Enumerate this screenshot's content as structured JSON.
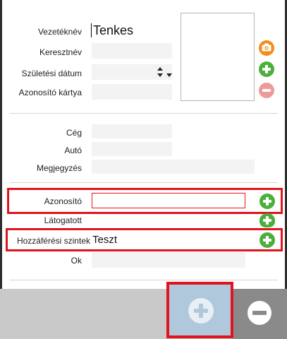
{
  "form": {
    "surname_label": "Vezetéknév",
    "surname_value": "Tenkes",
    "firstname_label": "Keresztnév",
    "firstname_value": "",
    "birthdate_label": "Születési dátum",
    "birthdate_value": "",
    "idcard_label": "Azonosító kártya",
    "idcard_value": "",
    "company_label": "Cég",
    "company_value": "",
    "car_label": "Autó",
    "car_value": "",
    "note_label": "Megjegyzés",
    "note_value": "",
    "identifier_label": "Azonosító",
    "identifier_value": "",
    "visited_label": "Látogatott",
    "access_label": "Hozzáférési szintek",
    "access_value": "Teszt",
    "reason_label": "Ok",
    "reason_value": ""
  },
  "icons": {
    "camera": "camera-icon",
    "plus": "plus-icon",
    "minus": "minus-icon",
    "spinner": "spinner-arrows-icon",
    "dropdown": "chevron-down-icon"
  },
  "colors": {
    "green_button": "#4caf3c",
    "pink_button": "#ef9a9a",
    "orange_button": "#f28c1b",
    "highlight_red": "#e0141e",
    "add_panel_blue": "#b0c8dc",
    "remove_panel_gray": "#8a8a8a"
  }
}
